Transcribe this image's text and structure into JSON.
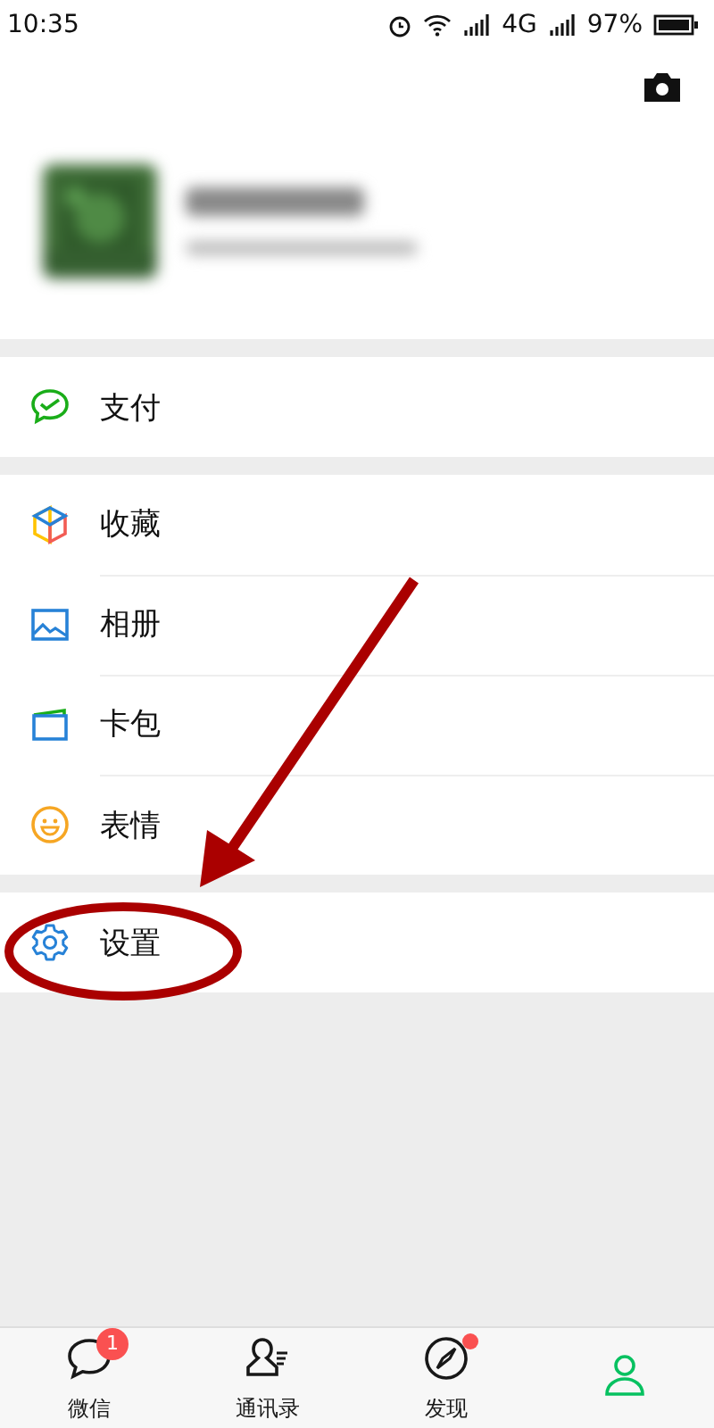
{
  "status_bar": {
    "time": "10:35",
    "network": "4G",
    "battery": "97%"
  },
  "menu_groups": [
    [
      {
        "kind": "pay",
        "label": "支付"
      }
    ],
    [
      {
        "kind": "favorites",
        "label": "收藏"
      },
      {
        "kind": "album",
        "label": "相册"
      },
      {
        "kind": "cards",
        "label": "卡包"
      },
      {
        "kind": "stickers",
        "label": "表情"
      }
    ],
    [
      {
        "kind": "settings",
        "label": "设置"
      }
    ]
  ],
  "tabs": [
    {
      "kind": "chats",
      "label": "微信",
      "badge": "1",
      "dot": false,
      "selected": false
    },
    {
      "kind": "contacts",
      "label": "通讯录",
      "dot": false,
      "selected": false
    },
    {
      "kind": "discover",
      "label": "发现",
      "dot": true,
      "selected": false
    },
    {
      "kind": "me",
      "selected": true
    }
  ]
}
